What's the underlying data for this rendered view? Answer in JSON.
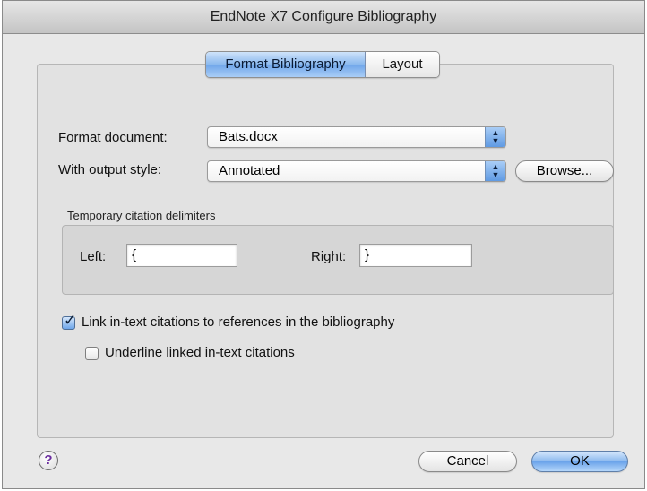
{
  "window": {
    "title": "EndNote X7 Configure Bibliography"
  },
  "tabs": [
    {
      "label": "Format Bibliography",
      "active": true
    },
    {
      "label": "Layout",
      "active": false
    }
  ],
  "format_document": {
    "label": "Format document:",
    "value": "Bats.docx"
  },
  "output_style": {
    "label": "With output style:",
    "value": "Annotated",
    "browse_label": "Browse..."
  },
  "delimiters": {
    "group_title": "Temporary citation delimiters",
    "left_label": "Left:",
    "left_value": "{",
    "right_label": "Right:",
    "right_value": "}"
  },
  "options": {
    "link_citations": {
      "label": "Link in-text citations to references in the bibliography",
      "checked": true
    },
    "underline_citations": {
      "label": "Underline linked in-text citations",
      "checked": false
    }
  },
  "footer": {
    "help_label": "?",
    "cancel_label": "Cancel",
    "ok_label": "OK"
  },
  "colors": {
    "accent": "#6fa6ea",
    "panel": "#e2e2e2",
    "window": "#e8e8e8"
  }
}
